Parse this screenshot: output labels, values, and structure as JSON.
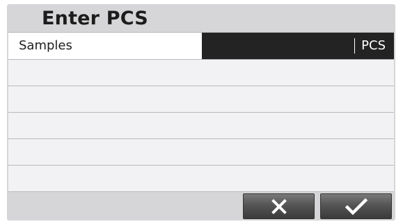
{
  "dialog": {
    "title": "Enter PCS"
  },
  "field": {
    "label": "Samples",
    "value": "",
    "unit": "PCS"
  },
  "buttons": {
    "cancel_icon": "x-icon",
    "confirm_icon": "check-icon"
  },
  "colors": {
    "background": "#d6d6d8",
    "value_field": "#232323",
    "row": "#f2f2f4",
    "button": "#555555"
  }
}
